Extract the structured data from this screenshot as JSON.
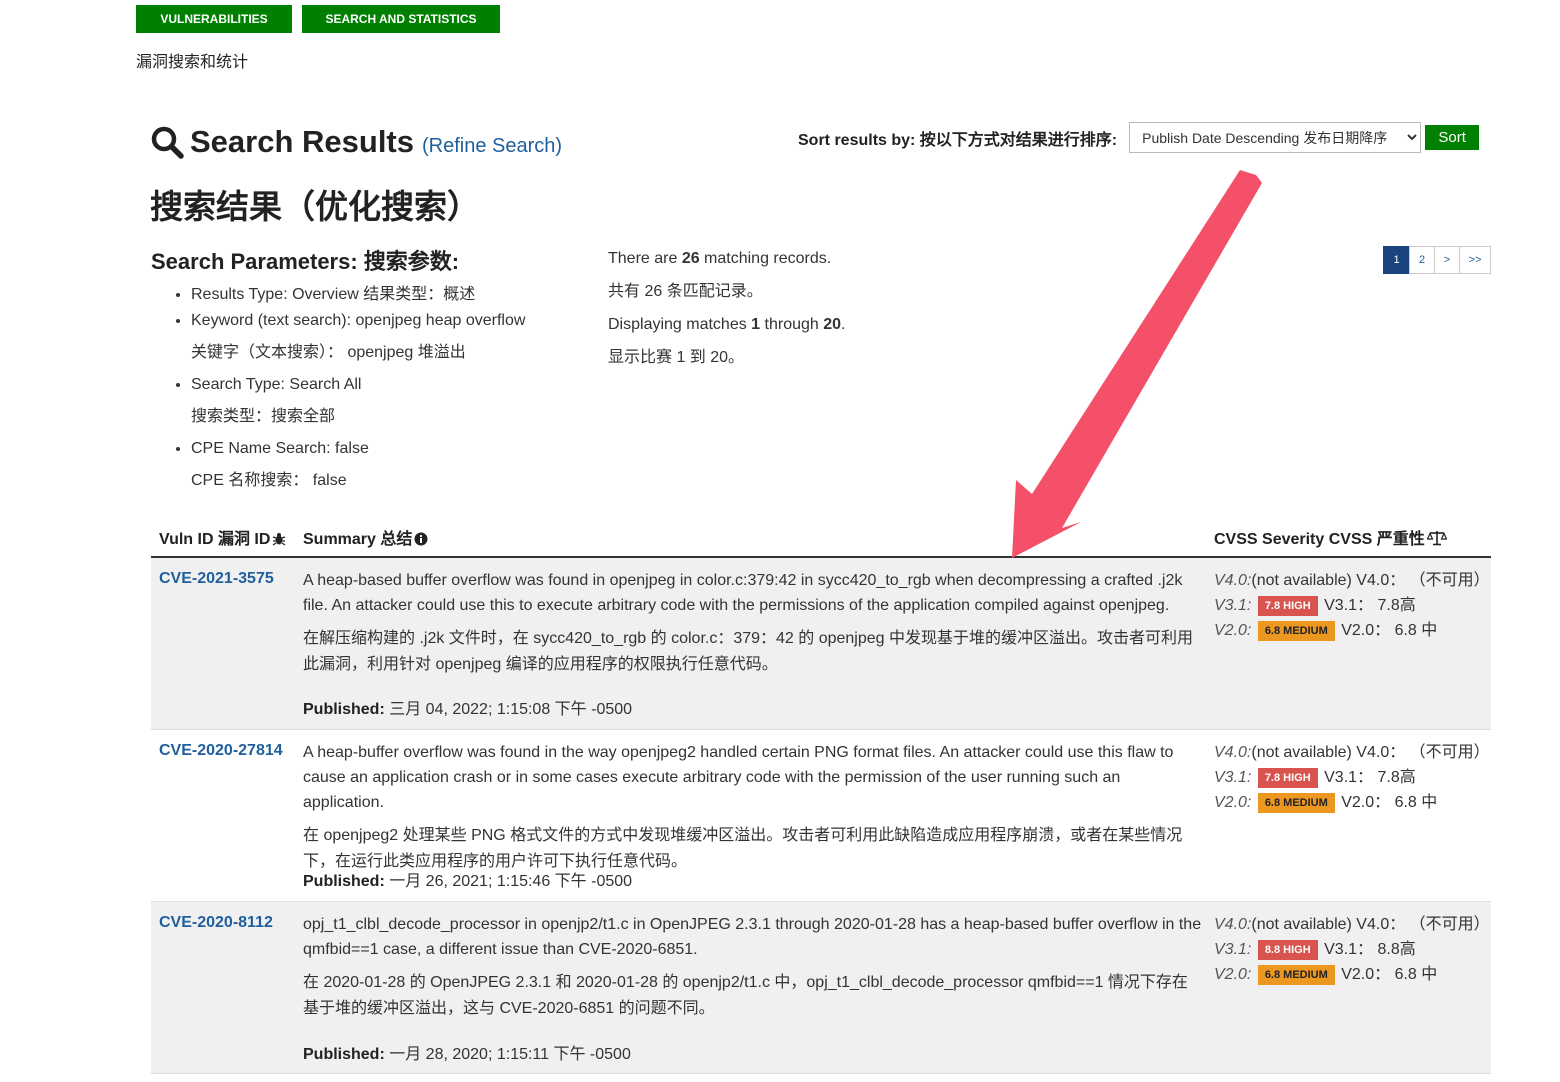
{
  "nav": {
    "vulnerabilities": "VULNERABILITIES",
    "search_stats": "SEARCH AND STATISTICS",
    "subtitle": "漏洞搜索和统计"
  },
  "results": {
    "title": "Search Results",
    "refine": "(Refine Search)",
    "cn_title": "搜索结果（优化搜索）"
  },
  "sort": {
    "label": "Sort results by:  按以下方式对结果进行排序:",
    "selected": "Publish Date Descending 发布日期降序",
    "button": "Sort"
  },
  "params": {
    "heading": "Search Parameters: 搜索参数:",
    "items": [
      {
        "en": "Results Type: Overview 结果类型：概述",
        "cn": ""
      },
      {
        "en": "Keyword (text search): openjpeg heap overflow",
        "cn": "关键字（文本搜索）： openjpeg 堆溢出"
      },
      {
        "en": "Search Type: Search All",
        "cn": "搜索类型：搜索全部"
      },
      {
        "en": "CPE Name Search: false",
        "cn": "CPE 名称搜索：  false"
      }
    ]
  },
  "counts": {
    "line1_a": "There are ",
    "line1_num": "26",
    "line1_b": " matching records.",
    "line2": "共有 26 条匹配记录。",
    "line3_a": "Displaying matches ",
    "line3_from": "1",
    "line3_mid": " through ",
    "line3_to": "20",
    "line3_b": ".",
    "line4": "显示比赛 1 到 20。"
  },
  "pager": {
    "p1": "1",
    "p2": "2",
    "next": ">",
    "last": ">>"
  },
  "table": {
    "col_id": "Vuln ID  漏洞 ID",
    "col_summary": "Summary  总结",
    "col_cvss": "CVSS Severity  CVSS 严重性"
  },
  "rows": [
    {
      "id": "CVE-2021-3575",
      "summary_en": "A heap-based buffer overflow was found in openjpeg in color.c:379:42 in sycc420_to_rgb when decompressing a crafted .j2k file. An attacker could use this to execute arbitrary code with the permissions of the application compiled against openjpeg.",
      "summary_cn": "在解压缩构建的 .j2k 文件时，在 sycc420_to_rgb 的 color.c：379：42 的 openjpeg 中发现基于堆的缓冲区溢出。攻击者可利用此漏洞，利用针对 openjpeg 编译的应用程序的权限执行任意代码。",
      "published_label": "Published:",
      "published": " 三月 04, 2022; 1:15:08 下午 -0500",
      "v4_label": "V4.0:",
      "v4": "(not available) V4.0：  （不可用）",
      "v31_label": "V3.1:",
      "v31_badge": "7.8 HIGH",
      "v31_after": " V3.1：  7.8高",
      "v20_label": "V2.0:",
      "v20_badge": "6.8 MEDIUM",
      "v20_after": " V2.0：  6.8 中"
    },
    {
      "id": "CVE-2020-27814",
      "summary_en": "A heap-buffer overflow was found in the way openjpeg2 handled certain PNG format files. An attacker could use this flaw to cause an application crash or in some cases execute arbitrary code with the permission of the user running such an application.",
      "summary_cn": "在 openjpeg2 处理某些 PNG 格式文件的方式中发现堆缓冲区溢出。攻击者可利用此缺陷造成应用程序崩溃，或者在某些情况下，在运行此类应用程序的用户许可下执行任意代码。",
      "published_label": "Published:",
      "published": " 一月 26, 2021; 1:15:46 下午 -0500",
      "v4_label": "V4.0:",
      "v4": "(not available) V4.0：  （不可用）",
      "v31_label": "V3.1:",
      "v31_badge": "7.8 HIGH",
      "v31_after": " V3.1：  7.8高",
      "v20_label": "V2.0:",
      "v20_badge": "6.8 MEDIUM",
      "v20_after": " V2.0：  6.8 中"
    },
    {
      "id": "CVE-2020-8112",
      "summary_en": "opj_t1_clbl_decode_processor in openjp2/t1.c in OpenJPEG 2.3.1 through 2020-01-28 has a heap-based buffer overflow in the qmfbid==1 case, a different issue than CVE-2020-6851.",
      "summary_cn": "在 2020-01-28 的 OpenJPEG 2.3.1 和 2020-01-28 的 openjp2/t1.c 中，opj_t1_clbl_decode_processor qmfbid==1 情况下存在基于堆的缓冲区溢出，这与 CVE-2020-6851 的问题不同。",
      "published_label": "Published:",
      "published": " 一月 28, 2020; 1:15:11 下午 -0500",
      "v4_label": "V4.0:",
      "v4": "(not available) V4.0：  （不可用）",
      "v31_label": "V3.1:",
      "v31_badge": "8.8 HIGH",
      "v31_after": " V3.1：  8.8高",
      "v20_label": "V2.0:",
      "v20_badge": "6.8 MEDIUM",
      "v20_after": " V2.0：  6.8 中"
    }
  ],
  "colors": {
    "green": "#008000",
    "link": "#1f5f9c",
    "high": "#d9534f",
    "medium": "#ec971f",
    "arrow": "#f5506a"
  }
}
